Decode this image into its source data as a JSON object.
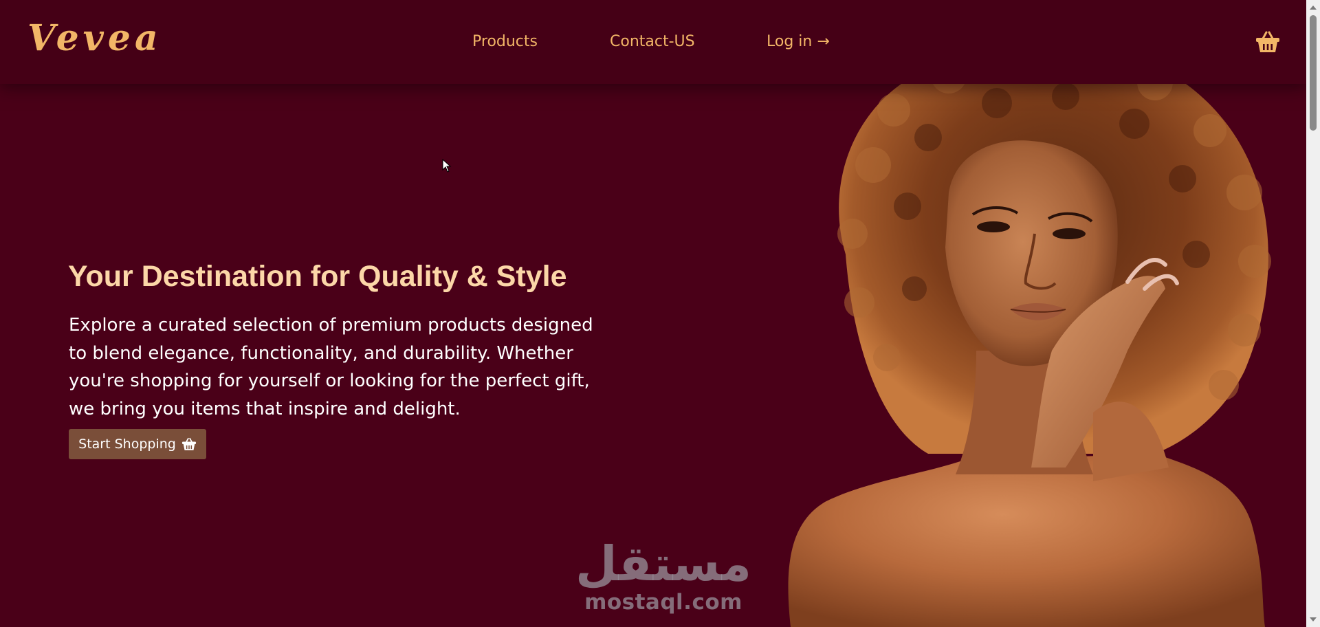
{
  "brand": {
    "logo_text": "Vevea"
  },
  "nav": {
    "products": "Products",
    "contact": "Contact-US",
    "login": "Log in →"
  },
  "cart": {
    "icon": "shopping-basket-icon"
  },
  "hero": {
    "title": "Your Destination for Quality & Style",
    "text": "Explore a curated selection of premium products designed to blend elegance, functionality, and durability. Whether you're shopping for yourself or looking for the perfect gift, we bring you items that inspire and delight.",
    "cta_label": "Start Shopping",
    "cta_icon": "shopping-basket-icon"
  },
  "watermark": {
    "arabic": "مستقل",
    "latin": "mostaql.com"
  },
  "colors": {
    "background": "#4a0018",
    "accent": "#f2b667",
    "title": "#fcd7a8",
    "button": "#7a4e39"
  }
}
